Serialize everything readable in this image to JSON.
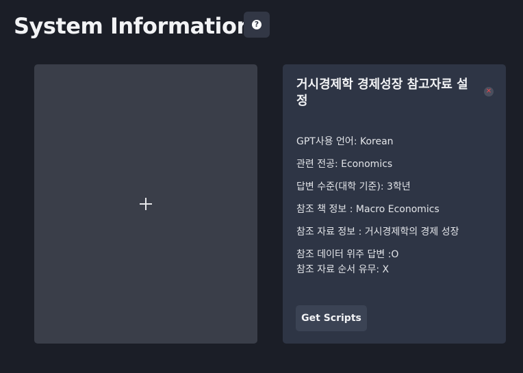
{
  "page": {
    "title": "System Information",
    "help_icon_glyph": "?"
  },
  "add_card": {
    "icon": "plus-icon"
  },
  "info_card": {
    "title": "거시경제학 경제성장 참고자료 설정",
    "close_icon_glyph": "✕",
    "lines": [
      "GPT사용 언어: Korean",
      "관련 전공: Economics",
      "답변 수준(대학 기준): 3학년",
      "참조 책 정보 : Macro Economics",
      "참조 자료 정보 : 거시경제학의 경제 성장",
      "참조 데이터 위주 답변 :O",
      "참조 자료 순서 유무: X"
    ],
    "button_label": "Get Scripts"
  },
  "colors": {
    "background": "#1b1e27",
    "add_card": "#3a3e49",
    "info_card": "#2e3545",
    "close_accent": "#e5484d"
  }
}
